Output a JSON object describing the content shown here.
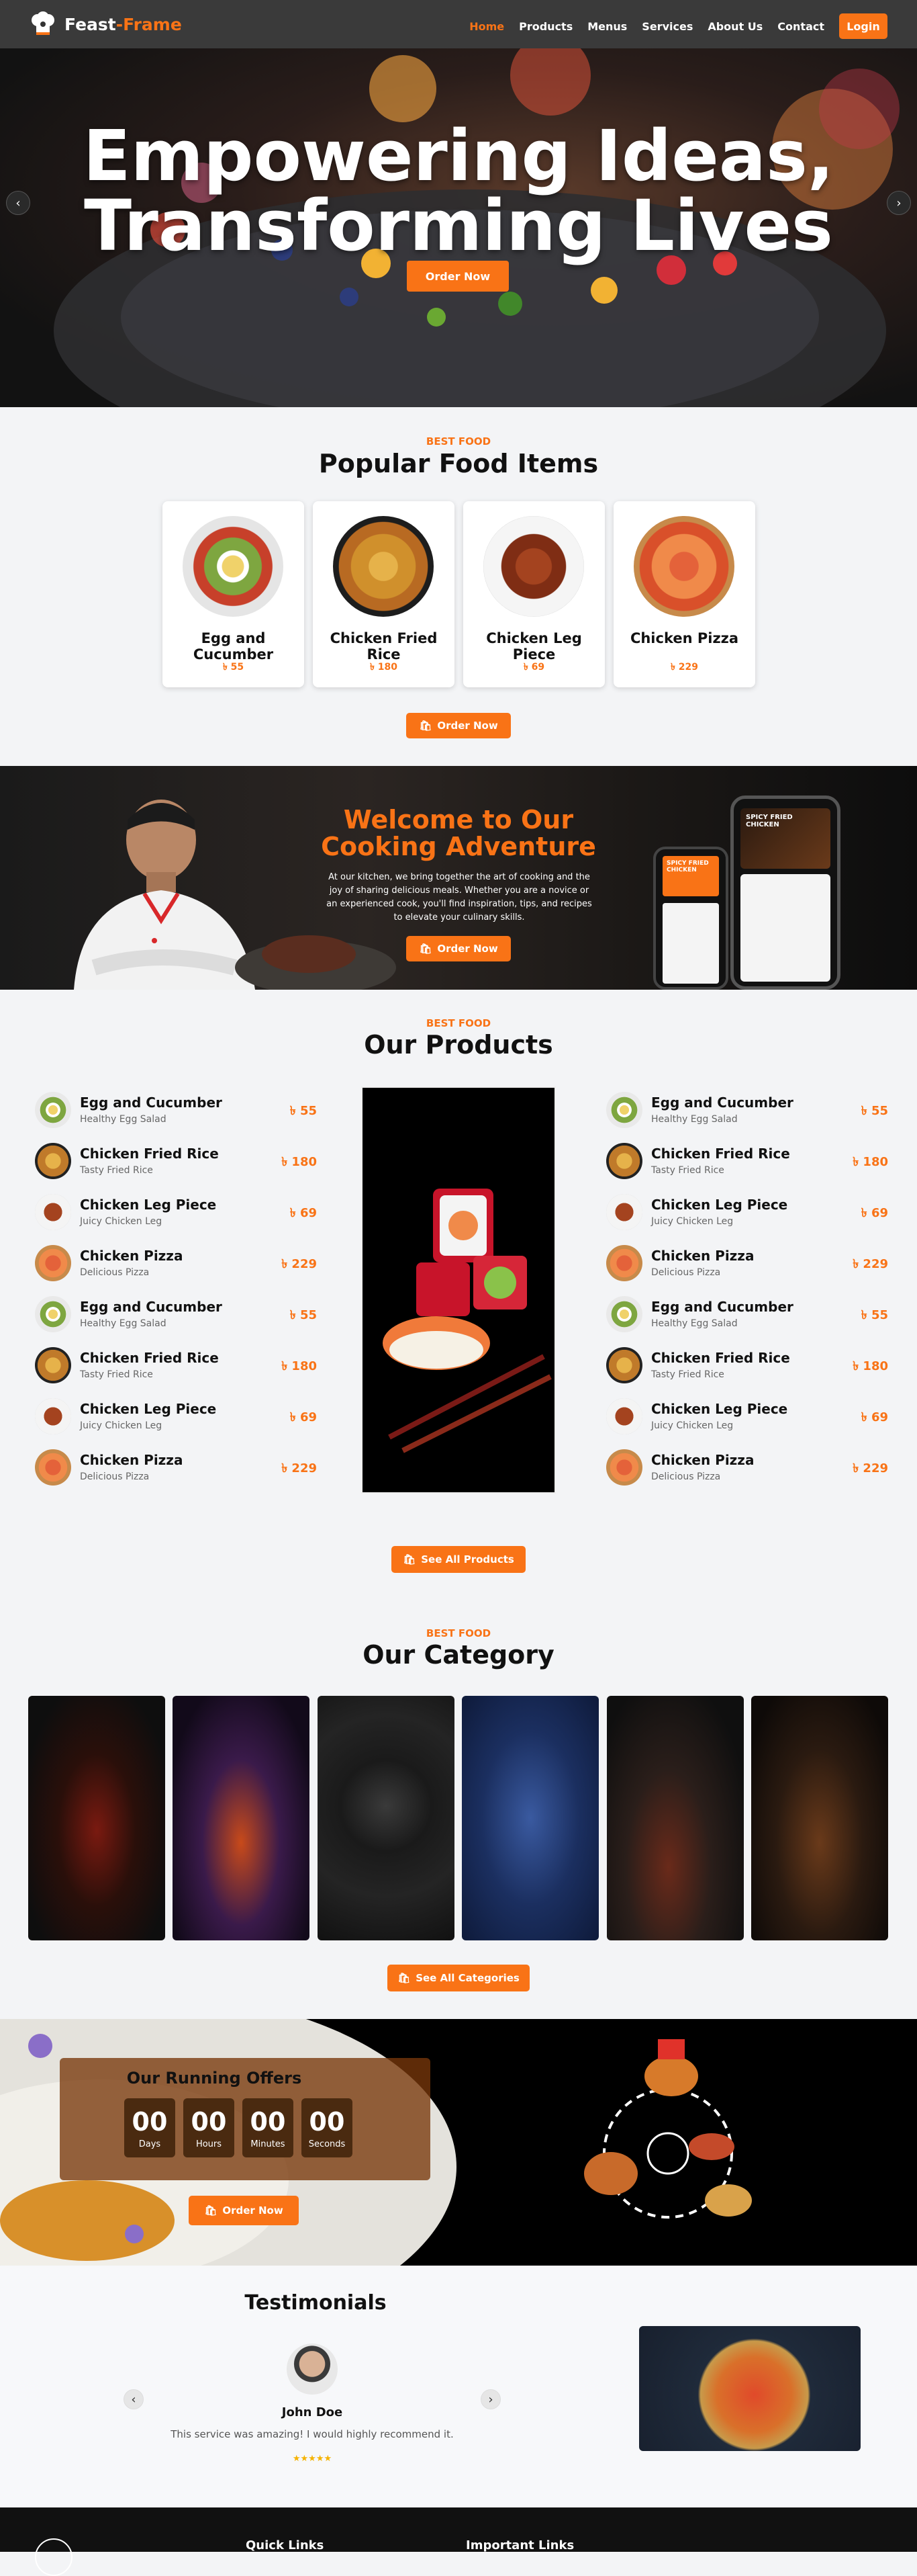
{
  "brand": {
    "name_part1": "Feast",
    "name_sep": "-",
    "name_part2": "Frame",
    "accent": "#f97316"
  },
  "nav": {
    "items": [
      {
        "label": "Home",
        "active": true
      },
      {
        "label": "Products"
      },
      {
        "label": "Menus"
      },
      {
        "label": "Services"
      },
      {
        "label": "About Us"
      },
      {
        "label": "Contact"
      }
    ],
    "login": "Login"
  },
  "hero": {
    "line1": "Empowering Ideas,",
    "line2": "Transforming Lives",
    "cta": "Order Now"
  },
  "popular": {
    "kicker": "BEST FOOD",
    "title": "Popular Food Items",
    "cta": "Order Now",
    "items": [
      {
        "name": "Egg and Cucumber",
        "price": "৳ 55"
      },
      {
        "name": "Chicken Fried Rice",
        "price": "৳ 180"
      },
      {
        "name": "Chicken Leg Piece",
        "price": "৳ 69"
      },
      {
        "name": "Chicken Pizza",
        "price": "৳ 229"
      }
    ]
  },
  "welcome": {
    "title_line1": "Welcome to Our",
    "title_line2": "Cooking Adventure",
    "text": "At our kitchen, we bring together the art of cooking and the joy of sharing delicious meals. Whether you are a novice or an experienced cook, you'll find inspiration, tips, and recipes to elevate your culinary skills.",
    "cta": "Order Now",
    "phone_label1": "SPICY FRIED CHICKEN",
    "phone_label2": "SPICY FRIED CHICKEN"
  },
  "products": {
    "kicker": "BEST FOOD",
    "title": "Our Products",
    "cta": "See All Products",
    "left": [
      {
        "name": "Egg and Cucumber",
        "desc": "Healthy Egg Salad",
        "price": "৳ 55"
      },
      {
        "name": "Chicken Fried Rice",
        "desc": "Tasty Fried Rice",
        "price": "৳ 180"
      },
      {
        "name": "Chicken Leg Piece",
        "desc": "Juicy Chicken Leg",
        "price": "৳ 69"
      },
      {
        "name": "Chicken Pizza",
        "desc": "Delicious Pizza",
        "price": "৳ 229"
      },
      {
        "name": "Egg and Cucumber",
        "desc": "Healthy Egg Salad",
        "price": "৳ 55"
      },
      {
        "name": "Chicken Fried Rice",
        "desc": "Tasty Fried Rice",
        "price": "৳ 180"
      },
      {
        "name": "Chicken Leg Piece",
        "desc": "Juicy Chicken Leg",
        "price": "৳ 69"
      },
      {
        "name": "Chicken Pizza",
        "desc": "Delicious Pizza",
        "price": "৳ 229"
      }
    ],
    "right": [
      {
        "name": "Egg and Cucumber",
        "desc": "Healthy Egg Salad",
        "price": "৳ 55"
      },
      {
        "name": "Chicken Fried Rice",
        "desc": "Tasty Fried Rice",
        "price": "৳ 180"
      },
      {
        "name": "Chicken Leg Piece",
        "desc": "Juicy Chicken Leg",
        "price": "৳ 69"
      },
      {
        "name": "Chicken Pizza",
        "desc": "Delicious Pizza",
        "price": "৳ 229"
      },
      {
        "name": "Egg and Cucumber",
        "desc": "Healthy Egg Salad",
        "price": "৳ 55"
      },
      {
        "name": "Chicken Fried Rice",
        "desc": "Tasty Fried Rice",
        "price": "৳ 180"
      },
      {
        "name": "Chicken Leg Piece",
        "desc": "Juicy Chicken Leg",
        "price": "৳ 69"
      },
      {
        "name": "Chicken Pizza",
        "desc": "Delicious Pizza",
        "price": "৳ 229"
      }
    ]
  },
  "category": {
    "kicker": "BEST FOOD",
    "title": "Our Category",
    "cta": "See All Categories"
  },
  "offers": {
    "title": "Our Running Offers",
    "cta": "Order Now",
    "counters": [
      {
        "value": "00",
        "label": "Days"
      },
      {
        "value": "00",
        "label": "Hours"
      },
      {
        "value": "00",
        "label": "Minutes"
      },
      {
        "value": "00",
        "label": "Seconds"
      }
    ]
  },
  "testimonials": {
    "title": "Testimonials",
    "name": "John Doe",
    "quote": "This service was amazing! I would highly recommend it.",
    "stars": "★★★★★"
  },
  "footer": {
    "col1": "Quick Links",
    "col2": "Important Links"
  }
}
